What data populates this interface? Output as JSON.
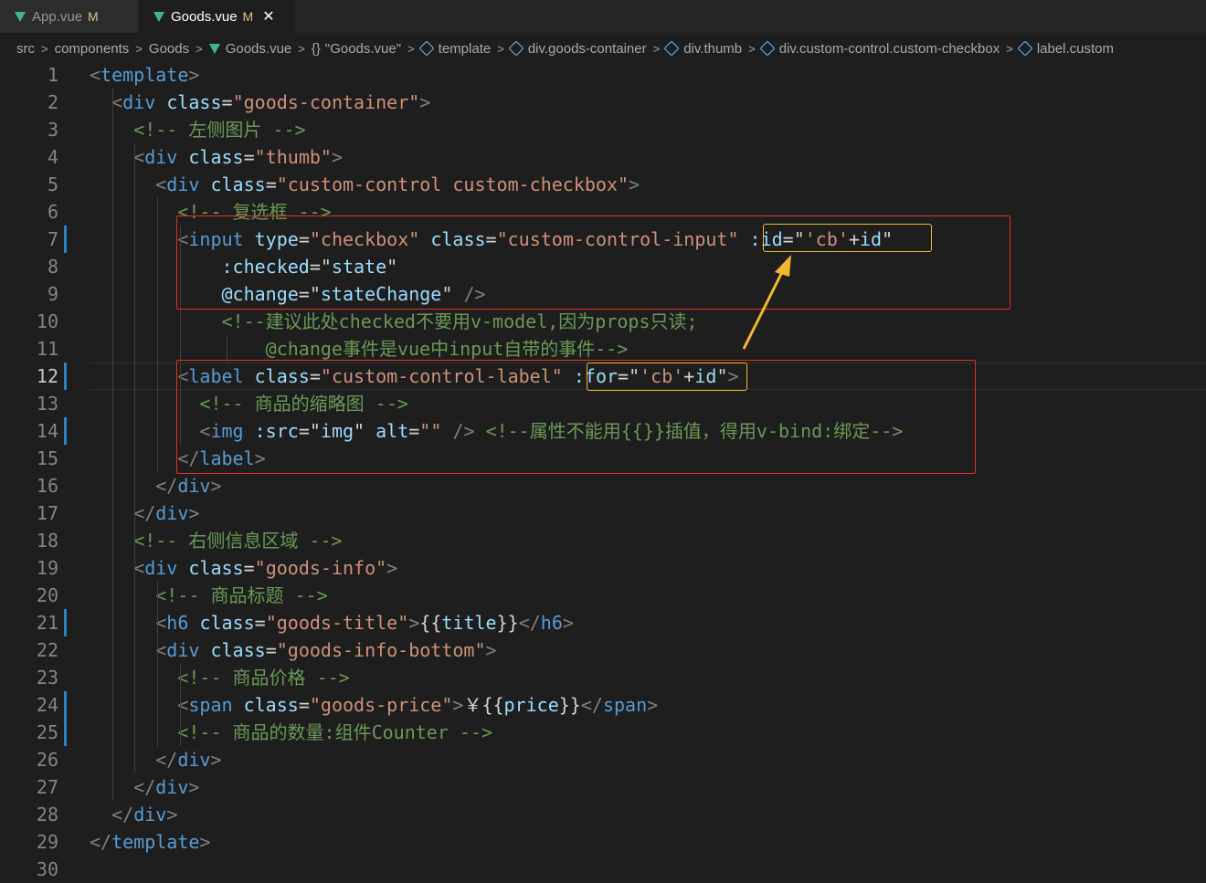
{
  "tabs": [
    {
      "label": "App.vue",
      "modified": "M",
      "active": false
    },
    {
      "label": "Goods.vue",
      "modified": "M",
      "active": true,
      "close": "✕"
    }
  ],
  "breadcrumb": [
    "src",
    "components",
    "Goods",
    "Goods.vue",
    "\"Goods.vue\"",
    "template",
    "div.goods-container",
    "div.thumb",
    "div.custom-control.custom-checkbox",
    "label.custom"
  ],
  "editor": {
    "current_line": 12,
    "lines": [
      {
        "n": "1",
        "tokens": [
          [
            "brk",
            "<"
          ],
          [
            "tag",
            "template"
          ],
          [
            "brk",
            ">"
          ]
        ]
      },
      {
        "n": "2",
        "tokens": [
          [
            "txt",
            "  "
          ],
          [
            "brk",
            "<"
          ],
          [
            "tag",
            "div"
          ],
          [
            "txt",
            " "
          ],
          [
            "attr",
            "class"
          ],
          [
            "pun",
            "="
          ],
          [
            "str",
            "\"goods-container\""
          ],
          [
            "brk",
            ">"
          ]
        ]
      },
      {
        "n": "3",
        "tokens": [
          [
            "txt",
            "    "
          ],
          [
            "com",
            "<!-- 左侧图片 -->"
          ]
        ]
      },
      {
        "n": "4",
        "tokens": [
          [
            "txt",
            "    "
          ],
          [
            "brk",
            "<"
          ],
          [
            "tag",
            "div"
          ],
          [
            "txt",
            " "
          ],
          [
            "attr",
            "class"
          ],
          [
            "pun",
            "="
          ],
          [
            "str",
            "\"thumb\""
          ],
          [
            "brk",
            ">"
          ]
        ]
      },
      {
        "n": "5",
        "tokens": [
          [
            "txt",
            "      "
          ],
          [
            "brk",
            "<"
          ],
          [
            "tag",
            "div"
          ],
          [
            "txt",
            " "
          ],
          [
            "attr",
            "class"
          ],
          [
            "pun",
            "="
          ],
          [
            "str",
            "\"custom-control custom-checkbox\""
          ],
          [
            "brk",
            ">"
          ]
        ]
      },
      {
        "n": "6",
        "tokens": [
          [
            "txt",
            "        "
          ],
          [
            "com",
            "<!-- 复选框 -->"
          ]
        ]
      },
      {
        "n": "7",
        "tokens": [
          [
            "txt",
            "        "
          ],
          [
            "brk",
            "<"
          ],
          [
            "tag",
            "input"
          ],
          [
            "txt",
            " "
          ],
          [
            "attr",
            "type"
          ],
          [
            "pun",
            "="
          ],
          [
            "str",
            "\"checkbox\""
          ],
          [
            "txt",
            " "
          ],
          [
            "attr",
            "class"
          ],
          [
            "pun",
            "="
          ],
          [
            "str",
            "\"custom-control-input\""
          ],
          [
            "txt",
            " "
          ],
          [
            "attr",
            ":id"
          ],
          [
            "pun",
            "=\""
          ],
          [
            "str",
            "'cb'"
          ],
          [
            "pun",
            "+"
          ],
          [
            "attr",
            "id"
          ],
          [
            "pun",
            "\""
          ]
        ]
      },
      {
        "n": "8",
        "tokens": [
          [
            "txt",
            "            "
          ],
          [
            "attr",
            ":checked"
          ],
          [
            "pun",
            "=\""
          ],
          [
            "attr",
            "state"
          ],
          [
            "pun",
            "\""
          ]
        ]
      },
      {
        "n": "9",
        "tokens": [
          [
            "txt",
            "            "
          ],
          [
            "attr",
            "@change"
          ],
          [
            "pun",
            "=\""
          ],
          [
            "attr",
            "stateChange"
          ],
          [
            "pun",
            "\""
          ],
          [
            "txt",
            " "
          ],
          [
            "brk",
            "/>"
          ]
        ]
      },
      {
        "n": "10",
        "tokens": [
          [
            "txt",
            "            "
          ],
          [
            "com",
            "<!--建议此处checked不要用v-model,因为props只读;"
          ]
        ]
      },
      {
        "n": "11",
        "tokens": [
          [
            "txt",
            "                "
          ],
          [
            "com",
            "@change事件是vue中input自带的事件-->"
          ]
        ]
      },
      {
        "n": "12",
        "tokens": [
          [
            "txt",
            "        "
          ],
          [
            "brk",
            "<"
          ],
          [
            "tag",
            "label"
          ],
          [
            "txt",
            " "
          ],
          [
            "attr",
            "class"
          ],
          [
            "pun",
            "="
          ],
          [
            "str",
            "\"custom-control-label\""
          ],
          [
            "txt",
            " "
          ],
          [
            "attr",
            ":for"
          ],
          [
            "pun",
            "=\""
          ],
          [
            "str",
            "'cb'"
          ],
          [
            "pun",
            "+"
          ],
          [
            "attr",
            "id"
          ],
          [
            "pun",
            "\""
          ],
          [
            "brk",
            ">"
          ]
        ]
      },
      {
        "n": "13",
        "tokens": [
          [
            "txt",
            "          "
          ],
          [
            "com",
            "<!-- 商品的缩略图 -->"
          ]
        ]
      },
      {
        "n": "14",
        "tokens": [
          [
            "txt",
            "          "
          ],
          [
            "brk",
            "<"
          ],
          [
            "tag",
            "img"
          ],
          [
            "txt",
            " "
          ],
          [
            "attr",
            ":src"
          ],
          [
            "pun",
            "=\""
          ],
          [
            "attr",
            "img"
          ],
          [
            "pun",
            "\""
          ],
          [
            "txt",
            " "
          ],
          [
            "attr",
            "alt"
          ],
          [
            "pun",
            "="
          ],
          [
            "str",
            "\"\""
          ],
          [
            "txt",
            " "
          ],
          [
            "brk",
            "/>"
          ],
          [
            "txt",
            " "
          ],
          [
            "com",
            "<!--属性不能用{{}}插值，得用v-bind:绑定-->"
          ]
        ]
      },
      {
        "n": "15",
        "tokens": [
          [
            "txt",
            "        "
          ],
          [
            "brk",
            "</"
          ],
          [
            "tag",
            "label"
          ],
          [
            "brk",
            ">"
          ]
        ]
      },
      {
        "n": "16",
        "tokens": [
          [
            "txt",
            "      "
          ],
          [
            "brk",
            "</"
          ],
          [
            "tag",
            "div"
          ],
          [
            "brk",
            ">"
          ]
        ]
      },
      {
        "n": "17",
        "tokens": [
          [
            "txt",
            "    "
          ],
          [
            "brk",
            "</"
          ],
          [
            "tag",
            "div"
          ],
          [
            "brk",
            ">"
          ]
        ]
      },
      {
        "n": "18",
        "tokens": [
          [
            "txt",
            "    "
          ],
          [
            "com",
            "<!-- 右侧信息区域 -->"
          ]
        ]
      },
      {
        "n": "19",
        "tokens": [
          [
            "txt",
            "    "
          ],
          [
            "brk",
            "<"
          ],
          [
            "tag",
            "div"
          ],
          [
            "txt",
            " "
          ],
          [
            "attr",
            "class"
          ],
          [
            "pun",
            "="
          ],
          [
            "str",
            "\"goods-info\""
          ],
          [
            "brk",
            ">"
          ]
        ]
      },
      {
        "n": "20",
        "tokens": [
          [
            "txt",
            "      "
          ],
          [
            "com",
            "<!-- 商品标题 -->"
          ]
        ]
      },
      {
        "n": "21",
        "tokens": [
          [
            "txt",
            "      "
          ],
          [
            "brk",
            "<"
          ],
          [
            "tag",
            "h6"
          ],
          [
            "txt",
            " "
          ],
          [
            "attr",
            "class"
          ],
          [
            "pun",
            "="
          ],
          [
            "str",
            "\"goods-title\""
          ],
          [
            "brk",
            ">"
          ],
          [
            "txt",
            "{{"
          ],
          [
            "attr",
            "title"
          ],
          [
            "txt",
            "}}"
          ],
          [
            "brk",
            "</"
          ],
          [
            "tag",
            "h6"
          ],
          [
            "brk",
            ">"
          ]
        ]
      },
      {
        "n": "22",
        "tokens": [
          [
            "txt",
            "      "
          ],
          [
            "brk",
            "<"
          ],
          [
            "tag",
            "div"
          ],
          [
            "txt",
            " "
          ],
          [
            "attr",
            "class"
          ],
          [
            "pun",
            "="
          ],
          [
            "str",
            "\"goods-info-bottom\""
          ],
          [
            "brk",
            ">"
          ]
        ]
      },
      {
        "n": "23",
        "tokens": [
          [
            "txt",
            "        "
          ],
          [
            "com",
            "<!-- 商品价格 -->"
          ]
        ]
      },
      {
        "n": "24",
        "tokens": [
          [
            "txt",
            "        "
          ],
          [
            "brk",
            "<"
          ],
          [
            "tag",
            "span"
          ],
          [
            "txt",
            " "
          ],
          [
            "attr",
            "class"
          ],
          [
            "pun",
            "="
          ],
          [
            "str",
            "\"goods-price\""
          ],
          [
            "brk",
            ">"
          ],
          [
            "txt",
            "￥{{"
          ],
          [
            "attr",
            "price"
          ],
          [
            "txt",
            "}}"
          ],
          [
            "brk",
            "</"
          ],
          [
            "tag",
            "span"
          ],
          [
            "brk",
            ">"
          ]
        ]
      },
      {
        "n": "25",
        "tokens": [
          [
            "txt",
            "        "
          ],
          [
            "com",
            "<!-- 商品的数量:组件Counter -->"
          ]
        ]
      },
      {
        "n": "26",
        "tokens": [
          [
            "txt",
            "      "
          ],
          [
            "brk",
            "</"
          ],
          [
            "tag",
            "div"
          ],
          [
            "brk",
            ">"
          ]
        ]
      },
      {
        "n": "27",
        "tokens": [
          [
            "txt",
            "    "
          ],
          [
            "brk",
            "</"
          ],
          [
            "tag",
            "div"
          ],
          [
            "brk",
            ">"
          ]
        ]
      },
      {
        "n": "28",
        "tokens": [
          [
            "txt",
            "  "
          ],
          [
            "brk",
            "</"
          ],
          [
            "tag",
            "div"
          ],
          [
            "brk",
            ">"
          ]
        ]
      },
      {
        "n": "29",
        "tokens": [
          [
            "brk",
            "</"
          ],
          [
            "tag",
            "template"
          ],
          [
            "brk",
            ">"
          ]
        ]
      },
      {
        "n": "30",
        "tokens": []
      }
    ],
    "modified_lines": [
      7,
      12,
      14,
      21,
      24,
      25
    ]
  },
  "colors": {
    "background": "#1e1e1e",
    "tag": "#569cd6",
    "attr": "#9cdcfe",
    "string": "#ce9178",
    "comment": "#6a9955",
    "annotation_red": "#e8311e",
    "annotation_yellow": "#f3b72f"
  }
}
